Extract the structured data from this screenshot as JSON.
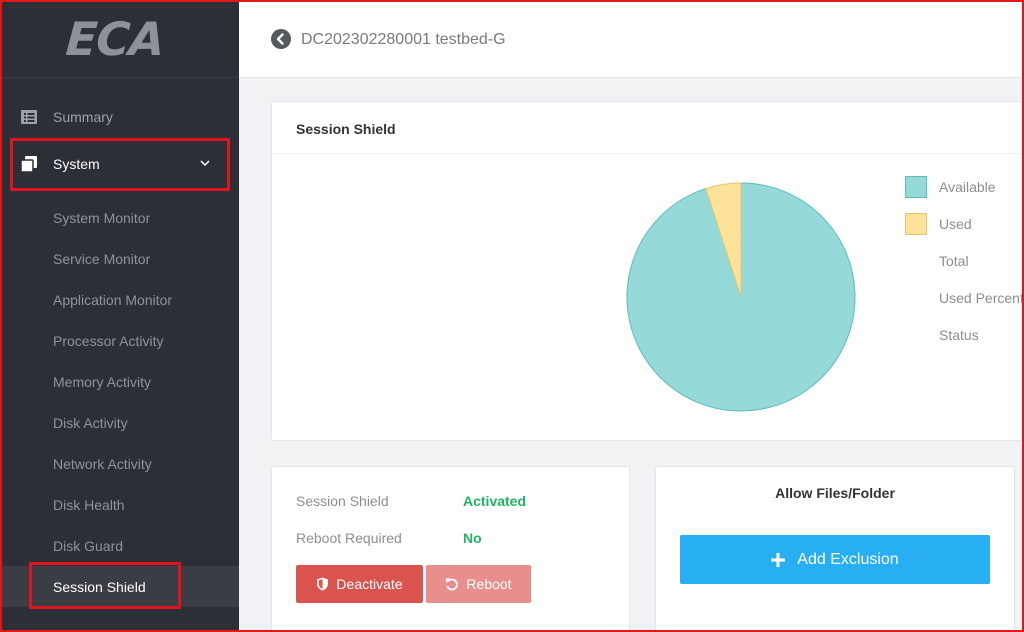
{
  "sidebar": {
    "logo": "ECA",
    "summary_label": "Summary",
    "system_label": "System",
    "items": [
      {
        "label": "System Monitor"
      },
      {
        "label": "Service Monitor"
      },
      {
        "label": "Application Monitor"
      },
      {
        "label": "Processor Activity"
      },
      {
        "label": "Memory Activity"
      },
      {
        "label": "Disk Activity"
      },
      {
        "label": "Network Activity"
      },
      {
        "label": "Disk Health"
      },
      {
        "label": "Disk Guard"
      },
      {
        "label": "Session Shield"
      }
    ]
  },
  "header": {
    "title": "DC202302280001 testbed-G"
  },
  "shield_card": {
    "title": "Session Shield",
    "legend": {
      "available": "Available",
      "used": "Used",
      "total": "Total",
      "used_percent": "Used Percent",
      "status": "Status"
    },
    "colors": {
      "available": "#95dad9",
      "available_border": "#5dbdb9",
      "used": "#fde29a",
      "used_border": "#e8c56b"
    }
  },
  "chart_data": {
    "type": "pie",
    "categories": [
      "Available",
      "Used"
    ],
    "values": [
      95,
      5
    ]
  },
  "info_card": {
    "shield_label": "Session Shield",
    "shield_value": "Activated",
    "reboot_label": "Reboot Required",
    "reboot_value": "No",
    "deactivate_label": "Deactivate",
    "reboot_button_label": "Reboot"
  },
  "allow_card": {
    "title": "Allow Files/Folder",
    "add_label": "Add Exclusion"
  }
}
